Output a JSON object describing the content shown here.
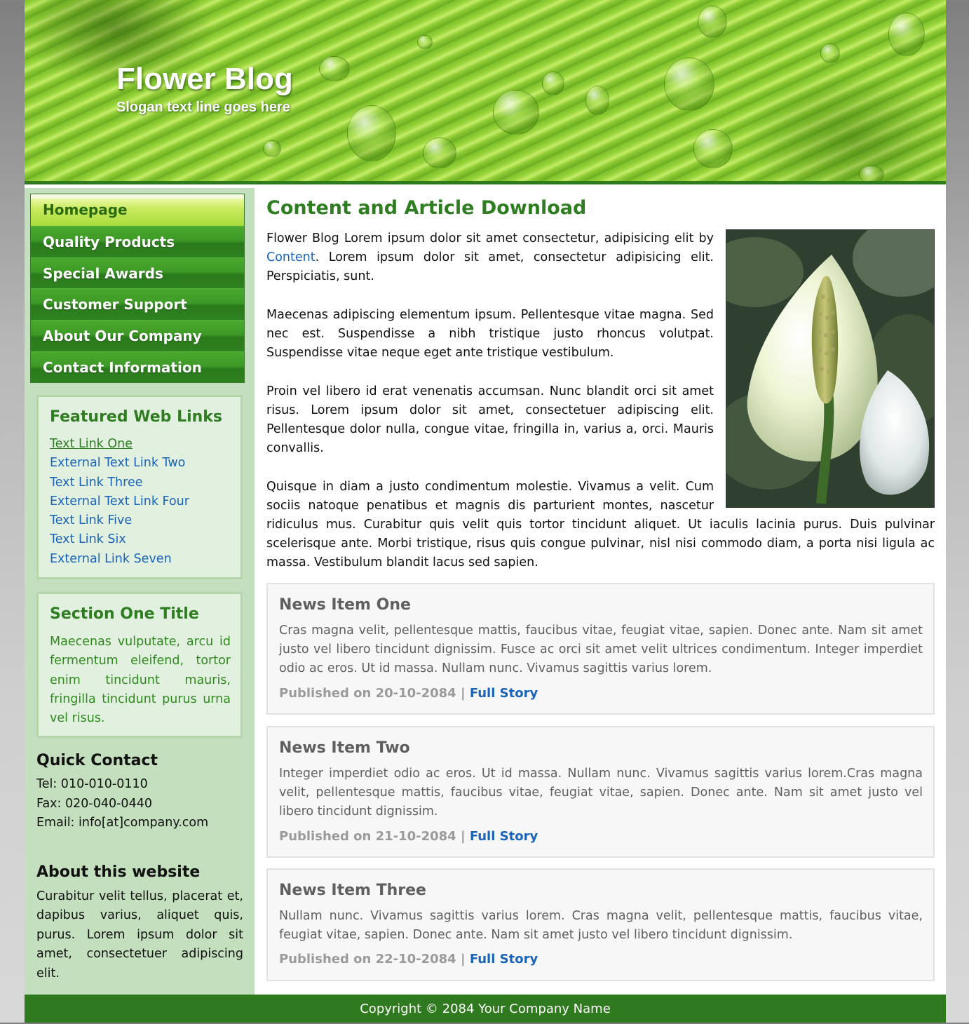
{
  "header": {
    "title": "Flower Blog",
    "slogan": "Slogan text line goes here"
  },
  "nav": {
    "items": [
      {
        "label": "Homepage"
      },
      {
        "label": "Quality Products"
      },
      {
        "label": "Special Awards"
      },
      {
        "label": "Customer Support"
      },
      {
        "label": "About Our Company"
      },
      {
        "label": "Contact Information"
      }
    ]
  },
  "featured_links": {
    "title": "Featured Web Links",
    "links": [
      "Text Link One",
      "External Text Link Two",
      "Text Link Three",
      "External Text Link Four",
      "Text Link Five",
      "Text Link Six",
      "External Link Seven"
    ]
  },
  "section_one": {
    "title": "Section One Title",
    "text": "Maecenas vulputate, arcu id fermentum eleifend, tortor enim tincidunt mauris, fringilla tincidunt purus urna vel risus."
  },
  "quick_contact": {
    "title": "Quick Contact",
    "tel": "Tel: 010-010-0110",
    "fax": "Fax: 020-040-0440",
    "email": "Email: info[at]company.com"
  },
  "about": {
    "title": "About this website",
    "text": "Curabitur velit tellus, placerat et, dapibus varius, aliquet quis, purus. Lorem ipsum dolor sit amet, consectetuer adipiscing elit."
  },
  "main": {
    "title": "Content and Article Download",
    "p1_before": "Flower Blog Lorem ipsum dolor sit amet consectetur, adipisicing elit by ",
    "p1_link": "Content",
    "p1_after": ". Lorem ipsum dolor sit amet, consectetur adipisicing elit. Perspiciatis, sunt.",
    "p2": "Maecenas adipiscing elementum ipsum. Pellentesque vitae magna. Sed nec est. Suspendisse a nibh tristique justo rhoncus volutpat. Suspendisse vitae neque eget ante tristique vestibulum.",
    "p3": "Proin vel libero id erat venenatis accumsan. Nunc blandit orci sit amet risus. Lorem ipsum dolor sit amet, consectetuer adipiscing elit. Pellentesque dolor nulla, congue vitae, fringilla in, varius a, orci. Mauris convallis.",
    "p4": "Quisque in diam a justo condimentum molestie. Vivamus a velit. Cum sociis natoque penatibus et magnis dis parturient montes, nascetur ridiculus mus. Curabitur quis velit quis tortor tincidunt aliquet. Ut iaculis lacinia purus. Duis pulvinar scelerisque ante. Morbi tristique, risus quis congue pulvinar, nisl nisi commodo diam, a porta nisi ligula ac massa. Vestibulum blandit lacus sed sapien."
  },
  "news": [
    {
      "title": "News Item One",
      "body": "Cras magna velit, pellentesque mattis, faucibus vitae, feugiat vitae, sapien. Donec ante. Nam sit amet justo vel libero tincidunt dignissim. Fusce ac orci sit amet velit ultrices condimentum. Integer imperdiet odio ac eros. Ut id massa. Nullam nunc. Vivamus sagittis varius lorem.",
      "published": "Published on 20-10-2084",
      "sep": " | ",
      "link": "Full Story"
    },
    {
      "title": "News Item Two",
      "body": "Integer imperdiet odio ac eros. Ut id massa. Nullam nunc. Vivamus sagittis varius lorem.Cras magna velit, pellentesque mattis, faucibus vitae, feugiat vitae, sapien. Donec ante. Nam sit amet justo vel libero tincidunt dignissim.",
      "published": "Published on 21-10-2084",
      "sep": " | ",
      "link": "Full Story"
    },
    {
      "title": "News Item Three",
      "body": "Nullam nunc. Vivamus sagittis varius lorem. Cras magna velit, pellentesque mattis, faucibus vitae, feugiat vitae, sapien. Donec ante. Nam sit amet justo vel libero tincidunt dignissim.",
      "published": "Published on 22-10-2084",
      "sep": " | ",
      "link": "Full Story"
    }
  ],
  "footer": {
    "copyright": "Copyright © 2084 Your Company Name"
  },
  "colors": {
    "brand_green": "#2f7d21",
    "link_blue": "#1a63b8",
    "sidebar_bg": "#c4dfbd",
    "footer_bg": "#2f7a1e"
  }
}
